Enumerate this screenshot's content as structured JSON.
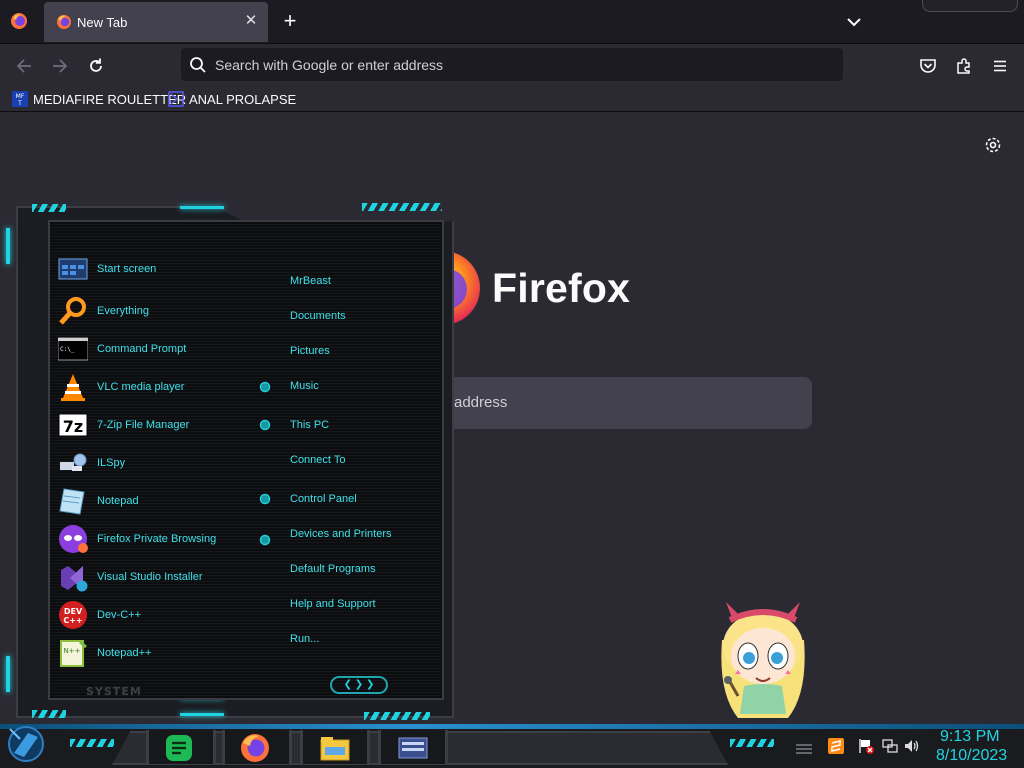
{
  "browser": {
    "tab": {
      "title": "New Tab",
      "close_glyph": "✕"
    },
    "new_tab_glyph": "+",
    "address_placeholder": "Search with Google or enter address",
    "bookmarks": [
      {
        "label": "MEDIAFIRE ROULETTER",
        "icon": "mediafire-icon"
      },
      {
        "label": "ANAL PROLAPSE",
        "icon": "bookmark-icon"
      }
    ],
    "icons": [
      "firefox-icon",
      "back-icon",
      "forward-icon",
      "reload-icon",
      "search-icon",
      "pocket-icon",
      "extensions-icon",
      "menu-icon",
      "list-all-tabs-icon",
      "settings-icon"
    ]
  },
  "newtab": {
    "wordmark": "Firefox",
    "search_placeholder": "address"
  },
  "start_menu": {
    "programs": [
      {
        "label": "Start screen",
        "icon": "start-screen-icon"
      },
      {
        "label": "Everything",
        "icon": "magnifier-icon"
      },
      {
        "label": "Command Prompt",
        "icon": "cmd-icon"
      },
      {
        "label": "VLC media player",
        "icon": "vlc-icon"
      },
      {
        "label": "7-Zip File Manager",
        "icon": "7zip-icon"
      },
      {
        "label": "ILSpy",
        "icon": "ilspy-icon"
      },
      {
        "label": "Notepad",
        "icon": "notepad-icon"
      },
      {
        "label": "Firefox Private Browsing",
        "icon": "firefox-private-icon"
      },
      {
        "label": "Visual Studio Installer",
        "icon": "vs-installer-icon"
      },
      {
        "label": "Dev-C++",
        "icon": "devcpp-icon"
      },
      {
        "label": "Notepad++",
        "icon": "notepadpp-icon"
      }
    ],
    "places": [
      {
        "label": "MrBeast",
        "arrow": false
      },
      {
        "label": "Documents",
        "arrow": false
      },
      {
        "label": "Pictures",
        "arrow": false
      },
      {
        "label": "Music",
        "arrow": true
      },
      {
        "label": "This PC",
        "arrow": true
      },
      {
        "label": "Connect To",
        "arrow": false
      },
      {
        "label": "Control Panel",
        "arrow": true
      },
      {
        "label": "Devices and Printers",
        "arrow": true
      },
      {
        "label": "Default Programs",
        "arrow": false
      },
      {
        "label": "Help and Support",
        "arrow": false
      },
      {
        "label": "Run...",
        "arrow": false
      }
    ],
    "footer_label": "SYSTEM",
    "arrows_glyph": "❮ ❯ ❯"
  },
  "taskbar": {
    "apps": [
      "notes-icon",
      "firefox-icon",
      "file-explorer-icon",
      "control-panel-icon"
    ],
    "tray_icons": [
      "show-hidden-icon",
      "sublime-icon",
      "action-center-flag-icon",
      "network-icon",
      "volume-icon"
    ],
    "clock": {
      "time": "9:13 PM",
      "date": "8/10/2023"
    }
  },
  "colors": {
    "accent": "#1fd3e0",
    "browser_bg": "#2b2a33",
    "tabstrip_bg": "#1c1b22",
    "clock": "#21d4e2"
  }
}
